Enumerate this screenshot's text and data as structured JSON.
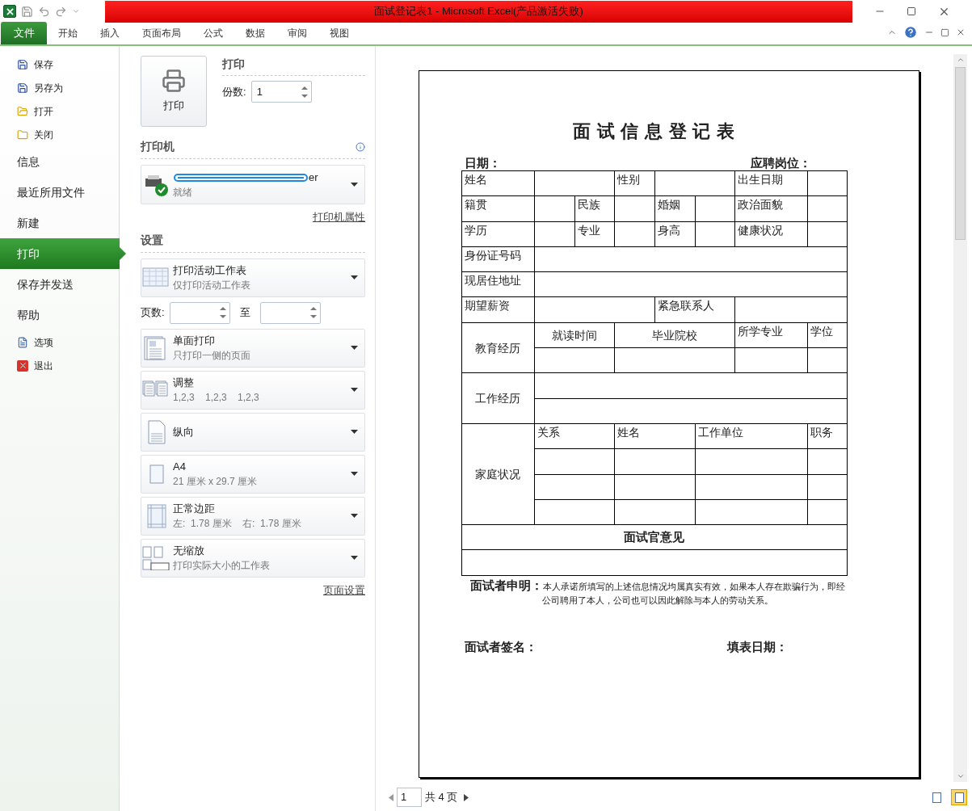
{
  "title_bar": {
    "title": "面试登记表1 - Microsoft Excel(产品激活失败)"
  },
  "ribbon_tabs": [
    {
      "label": "文件",
      "selected": true
    },
    {
      "label": "开始",
      "selected": false
    },
    {
      "label": "插入",
      "selected": false
    },
    {
      "label": "页面布局",
      "selected": false
    },
    {
      "label": "公式",
      "selected": false
    },
    {
      "label": "数据",
      "selected": false
    },
    {
      "label": "审阅",
      "selected": false
    },
    {
      "label": "视图",
      "selected": false
    }
  ],
  "backstage_menu": [
    {
      "label": "保存",
      "kind": "command",
      "selected": false
    },
    {
      "label": "另存为",
      "kind": "command",
      "selected": false
    },
    {
      "label": "打开",
      "kind": "command",
      "selected": false
    },
    {
      "label": "关闭",
      "kind": "command",
      "selected": false
    },
    {
      "label": "信息",
      "kind": "tab",
      "selected": false
    },
    {
      "label": "最近所用文件",
      "kind": "tab",
      "selected": false
    },
    {
      "label": "新建",
      "kind": "tab",
      "selected": false
    },
    {
      "label": "打印",
      "kind": "tab",
      "selected": true
    },
    {
      "label": "保存并发送",
      "kind": "tab",
      "selected": false
    },
    {
      "label": "帮助",
      "kind": "tab",
      "selected": false
    },
    {
      "label": "选项",
      "kind": "command",
      "selected": false
    },
    {
      "label": "退出",
      "kind": "command",
      "selected": false
    }
  ],
  "print": {
    "button": "打印",
    "heading": "打印",
    "copies_label": "份数:",
    "copies": "1"
  },
  "printer": {
    "heading": "打印机",
    "name": "er",
    "status": "就绪",
    "properties_link": "打印机属性"
  },
  "settings": {
    "heading": "设置",
    "pages_label": "页数:",
    "to_label": "至",
    "page_setup_link": "页面设置",
    "options": [
      {
        "title": "打印活动工作表",
        "subtitle": "仅打印活动工作表"
      },
      {
        "title": "单面打印",
        "subtitle": "只打印一侧的页面"
      },
      {
        "title": "调整",
        "subtitle": "1,2,3    1,2,3    1,2,3"
      },
      {
        "title": "纵向"
      },
      {
        "title": "A4",
        "subtitle": "21 厘米 x 29.7 厘米"
      },
      {
        "title": "正常边距",
        "subtitle": "左:  1.78 厘米    右:  1.78 厘米"
      },
      {
        "title": "无缩放",
        "subtitle": "打印实际大小的工作表"
      }
    ]
  },
  "preview": {
    "document": {
      "title": "面 试 信 息 登 记 表",
      "date_label": "日期：",
      "position_label": "应聘岗位：",
      "rows": [
        [
          {
            "text": "姓名"
          },
          {
            "colspan": 2
          },
          {
            "text": "性别"
          },
          {
            "colspan": 2
          },
          {
            "text": "出生日期"
          },
          {}
        ],
        [
          {
            "text": "籍贯"
          },
          {},
          {
            "text": "民族"
          },
          {},
          {
            "text": "婚姻"
          },
          {},
          {
            "text": "政治面貌"
          },
          {}
        ],
        [
          {
            "text": "学历"
          },
          {},
          {
            "text": "专业"
          },
          {},
          {
            "text": "身高"
          },
          {},
          {
            "text": "健康状况"
          },
          {}
        ],
        [
          {
            "text": "身份证号码"
          },
          {
            "colspan": 7
          }
        ],
        [
          {
            "text": "现居住地址"
          },
          {
            "colspan": 7
          }
        ],
        [
          {
            "text": "期望薪资"
          },
          {
            "colspan": 3
          },
          {
            "text": "紧急联系人",
            "colspan": 2
          },
          {
            "colspan": 2
          }
        ],
        [
          {
            "text": "教育经历",
            "rowspan": 2,
            "centered": true
          },
          {
            "text": "就读时间",
            "colspan": 2,
            "centered": true
          },
          {
            "text": "毕业院校",
            "colspan": 3,
            "centered": true
          },
          {
            "text": "所学专业"
          },
          {
            "text": "学位"
          }
        ],
        [
          {
            "colspan": 2
          },
          {
            "colspan": 3
          },
          {},
          {}
        ],
        [
          {
            "text": "工作经历",
            "rowspan": 2,
            "centered": true
          },
          {
            "colspan": 7
          }
        ],
        [
          {
            "colspan": 7
          }
        ],
        [
          {
            "text": "家庭状况",
            "rowspan": 4,
            "centered": true
          },
          {
            "text": "关系",
            "colspan": 2
          },
          {
            "text": "姓名",
            "colspan": 2
          },
          {
            "text": "工作单位",
            "colspan": 2
          },
          {
            "text": "职务"
          }
        ],
        [
          {
            "colspan": 2
          },
          {
            "colspan": 2
          },
          {
            "colspan": 2
          },
          {}
        ],
        [
          {
            "colspan": 2
          },
          {
            "colspan": 2
          },
          {
            "colspan": 2
          },
          {}
        ],
        [
          {
            "colspan": 2
          },
          {
            "colspan": 2
          },
          {
            "colspan": 2
          },
          {}
        ],
        [
          {
            "text": "面试官意见",
            "colspan": 8,
            "centered": true,
            "bold": true
          }
        ],
        [
          {
            "colspan": 8
          }
        ]
      ],
      "declaration": "**面试者申明：**本人承诺所填写的上述信息情况均属真实有效，如果本人存在欺骗行为，即经公司聘用了本人，公司也可以因此解除与本人的劳动关系。",
      "signature_label": "面试者签名：",
      "fill_date_label": "填表日期："
    },
    "page_input": "1",
    "page_count": "共 4 页"
  },
  "view_buttons": [
    {
      "selected": false
    },
    {
      "selected": true
    }
  ]
}
